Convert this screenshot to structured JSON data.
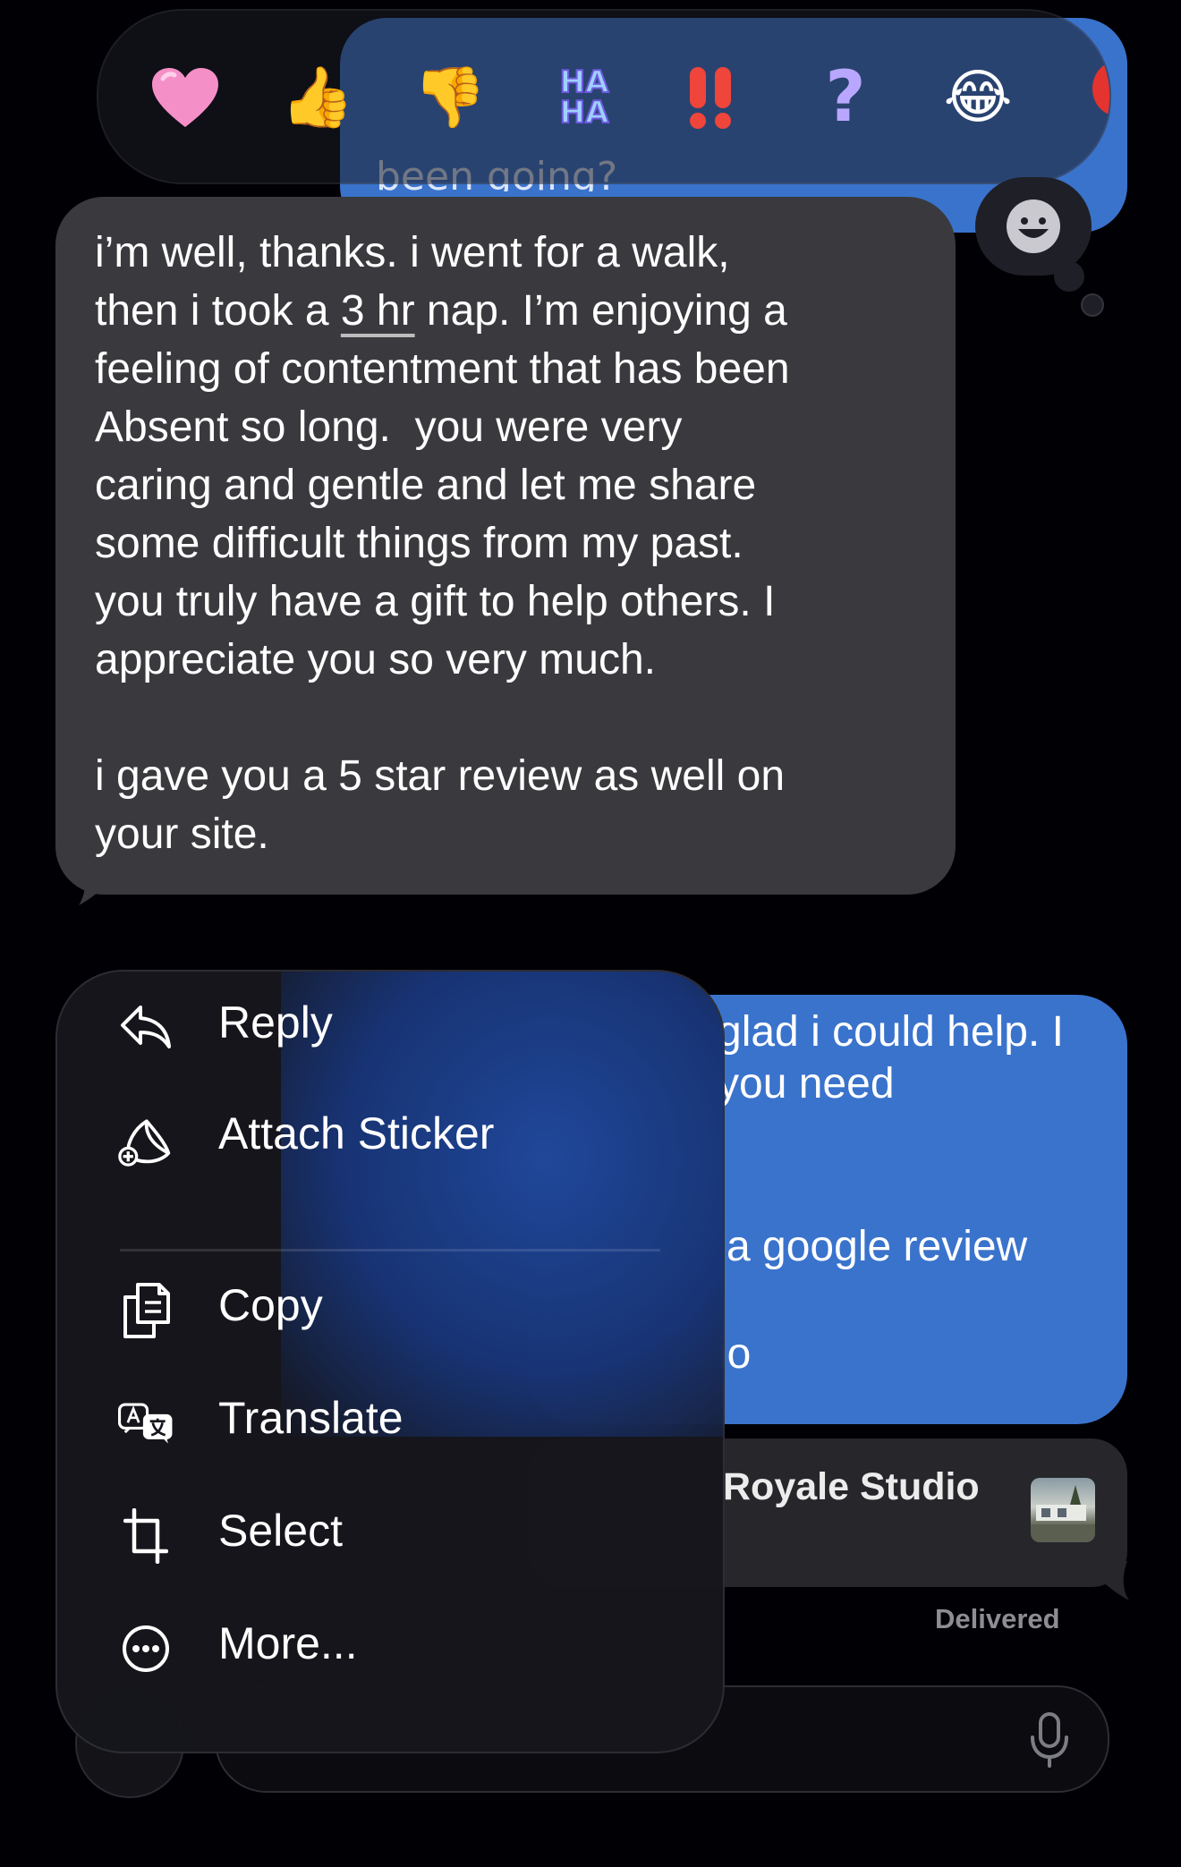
{
  "reactions": {
    "haha_label": "HA\nHA",
    "items": [
      "heart",
      "thumbs-up",
      "thumbs-down",
      "haha",
      "exclamation",
      "question",
      "laughing-emoji",
      "balloon"
    ]
  },
  "top_message": {
    "text": "been going?"
  },
  "received_message": {
    "line1": "i’m well, thanks. i went for a walk,",
    "line2_pre": "then i took a ",
    "line2_link": "3 hr",
    "line2_post": " nap. I’m enjoying a",
    "rest": "feeling of contentment that has been\nAbsent so long.  you were very\ncaring and gentle and let me share\nsome difficult things from my past.\nyou truly have a gift to help others. I\nappreciate you so very much.\n\ni gave you a 5 star review as well on\nyour site."
  },
  "sent_reply": {
    "line1": "glad i could help. I",
    "line2": "you need",
    "line3": "a google review",
    "line4": "io"
  },
  "link_preview": {
    "title": "Royale Studio"
  },
  "status": {
    "delivered": "Delivered"
  },
  "context_menu": {
    "reply": "Reply",
    "attach_sticker": "Attach Sticker",
    "copy": "Copy",
    "translate": "Translate",
    "select": "Select",
    "more": "More..."
  },
  "colors": {
    "background": "#000005",
    "sent_bubble": "#3a73cc",
    "received_bubble": "#3a3a3e",
    "menu": "#16161c"
  }
}
